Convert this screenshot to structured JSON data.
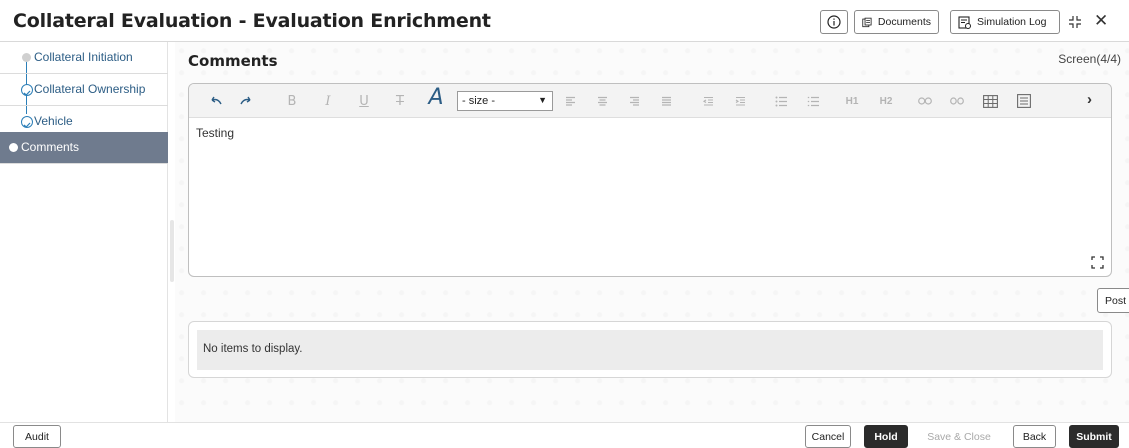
{
  "header": {
    "title": "Collateral Evaluation - Evaluation Enrichment",
    "documents_label": "Documents",
    "simulation_log_label": "Simulation Log"
  },
  "sidebar": {
    "items": [
      {
        "label": "Collateral Initiation",
        "state": "pending"
      },
      {
        "label": "Collateral Ownership",
        "state": "done"
      },
      {
        "label": "Vehicle",
        "state": "done"
      },
      {
        "label": "Comments",
        "state": "active"
      }
    ]
  },
  "main": {
    "title": "Comments",
    "screen_indicator": "Screen(4/4)",
    "editor": {
      "font_size_value": "- size -",
      "heading1_label": "H1",
      "heading2_label": "H2",
      "content": "Testing"
    },
    "post_label": "Post",
    "empty_message": "No items to display."
  },
  "footer": {
    "audit_label": "Audit",
    "cancel_label": "Cancel",
    "hold_label": "Hold",
    "save_close_label": "Save & Close",
    "back_label": "Back",
    "submit_label": "Submit"
  },
  "icons": {
    "info": "info-icon",
    "documents": "documents-icon",
    "simulation_log": "simulation-log-icon",
    "collapse": "collapse-icon",
    "close": "close-icon",
    "expand": "expand-icon"
  },
  "colors": {
    "accent": "#2c5d85",
    "active_step": "#6f7b8e",
    "primary_button": "#2b2b2b"
  }
}
